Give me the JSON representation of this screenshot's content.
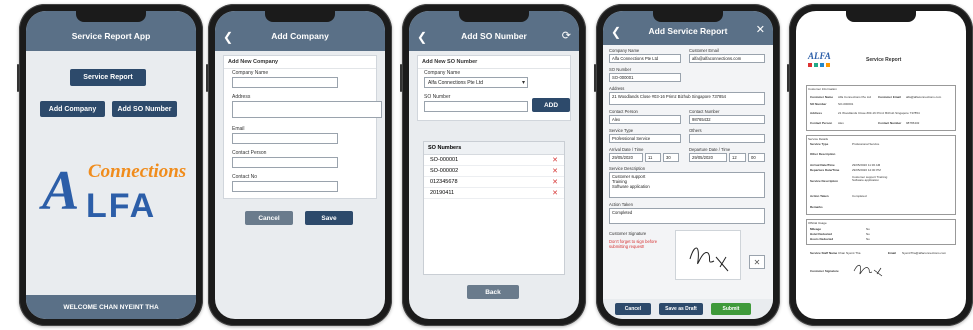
{
  "screen1": {
    "title": "Service Report App",
    "service_report_btn": "Service Report",
    "add_company_btn": "Add Company",
    "add_so_btn": "Add SO Number",
    "logo_a": "A",
    "logo_connections": "Connections",
    "logo_lfa": "LFA",
    "footer": "WELCOME CHAN NYEINT THA"
  },
  "screen2": {
    "title": "Add Company",
    "section": "Add New Company",
    "fields": [
      "Company Name",
      "Address",
      "Email",
      "Contact Person",
      "Contact No"
    ],
    "cancel": "Cancel",
    "save": "Save"
  },
  "screen3": {
    "title": "Add SO Number",
    "section": "Add New SO Number",
    "company_label": "Company Name",
    "company_value": "Alfa Connections Pte Ltd",
    "so_label": "SO Number",
    "add_btn": "ADD",
    "list_header": "SO Numbers",
    "items": [
      "SO-000001",
      "SO-000002",
      "012345678",
      "20190411"
    ],
    "back_btn": "Back"
  },
  "screen4": {
    "title": "Add Service Report",
    "company_label": "Company Name",
    "company_value": "Alfa Connections Pte Ltd",
    "email_label": "Customer Email",
    "email_value": "alfa@alfaconnections.com",
    "so_label": "SO Number",
    "so_value": "SO-000001",
    "address_label": "Address",
    "address_value": "21 Woodlands Close #03-16 Primz Bizhub Singapore 737854",
    "contact_person_label": "Contact Person",
    "contact_person_value": "Alex",
    "contact_number_label": "Contact Number",
    "contact_number_value": "98765432",
    "service_type_label": "Service Type",
    "service_type_value": "Professional Service",
    "others_label": "Others",
    "arrival_label": "Arrival Date / Time",
    "arrival_date": "29/05/2020",
    "departure_label": "Departure Date / Time",
    "departure_date": "29/05/2020",
    "time_h": "11",
    "time_m": "30",
    "dep_time_h": "12",
    "dep_time_m": "00",
    "desc_label": "Service Description",
    "desc_lines": [
      "Customer support",
      "Training",
      "Software application"
    ],
    "action_label": "Action Taken",
    "action_value": "Completed",
    "signature_label": "Customer Signature",
    "signature_warning": "Don't forget to sign before submitting request!",
    "cancel": "Cancel",
    "draft": "Save as Draft",
    "submit": "Submit"
  },
  "screen5": {
    "doc_title": "Service Report",
    "customer_info": "Customer Information",
    "customer_name_label": "Customer Name",
    "customer_name": "Alfa Connections Pte Ltd",
    "customer_email_label": "Customer Email",
    "customer_email": "alfa@alfaconnections.com",
    "so_label": "SO Number",
    "so_value": "SO-000001",
    "address_label": "Address",
    "address_value": "21 Woodlands Close #03-16 Primz Bizhub Singapore 737854",
    "contact_person_label": "Contact Person",
    "contact_person_value": "Alex",
    "contact_number_label": "Contact Number",
    "contact_number_value": "98765432",
    "service_details": "Service Details",
    "service_type_label": "Service Type",
    "service_type_value": "Professional Service",
    "other_desc_label": "Other Description",
    "arrival_label": "Arrival Date/Time",
    "arrival_value": "29/05/2020 11:30 AM",
    "departure_label": "Departure Date/Time",
    "departure_value": "29/05/2020 12:00 PM",
    "service_desc_label": "Service Description",
    "service_desc_value": "Customer support Training Software application",
    "action_label": "Action Taken",
    "action_value": "Completed",
    "remarks_label": "Remarks",
    "official_usage": "Official Usage",
    "mileage_label": "Mileage",
    "mileage_value": "No",
    "hotel_label": "Hotel Deducted",
    "hotel_value": "No",
    "hours_label": "Hours Deducted",
    "hours_value": "No",
    "staff_label": "Service Staff Name",
    "staff_value": "Chan Nyeint Tha",
    "email_label": "Email",
    "email_value": "NyeintTha@alfaconnections.com",
    "sig_label": "Customer Signature"
  },
  "colors": {
    "header": "#5a7087",
    "primary": "#2d4a6b",
    "submit": "#3f9a3a",
    "danger": "#d63333",
    "accent": "#f08c1c"
  }
}
